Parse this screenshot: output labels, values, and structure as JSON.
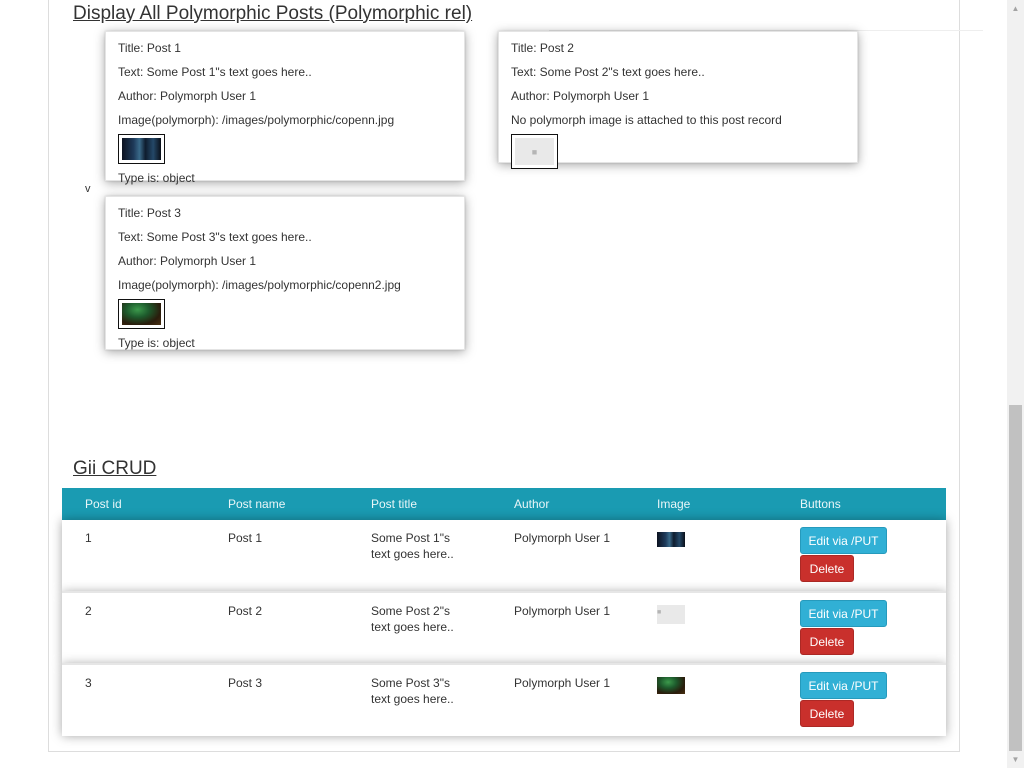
{
  "poly_section": {
    "title": "Display All Polymorphic Posts (Polymorphic rel)",
    "stray_char": "v",
    "posts": [
      {
        "title": "Title: Post 1",
        "text": "Text: Some Post 1\"s text goes here..",
        "author": "Author: Polymorph User 1",
        "image_line": "Image(polymorph): /images/polymorphic/copenn.jpg",
        "type_line": "Type is: object"
      },
      {
        "title": "Title: Post 2",
        "text": "Text: Some Post 2\"s text goes here..",
        "author": "Author: Polymorph User 1",
        "image_line": "No polymorph image is attached to this post record"
      },
      {
        "title": "Title: Post 3",
        "text": "Text: Some Post 3\"s text goes here..",
        "author": "Author: Polymorph User 1",
        "image_line": "Image(polymorph): /images/polymorphic/copenn2.jpg",
        "type_line": "Type is: object"
      }
    ]
  },
  "crud_section": {
    "title": "Gii CRUD",
    "columns": [
      "Post id",
      "Post name",
      "Post title",
      "Author",
      "Image",
      "Buttons"
    ],
    "rows": [
      {
        "id": "1",
        "name": "Post 1",
        "title": "Some Post 1\"s text goes here..",
        "author": "Polymorph User 1",
        "edit_label": "Edit via /PUT",
        "delete_label": "Delete"
      },
      {
        "id": "2",
        "name": "Post 2",
        "title": "Some Post 2\"s text goes here..",
        "author": "Polymorph User 1",
        "edit_label": "Edit via /PUT",
        "delete_label": "Delete"
      },
      {
        "id": "3",
        "name": "Post 3",
        "title": "Some Post 3\"s text goes here..",
        "author": "Polymorph User 1",
        "edit_label": "Edit via /PUT",
        "delete_label": "Delete"
      }
    ]
  },
  "colors": {
    "table_header": "#1a9bb2",
    "edit_button": "#31b0d5",
    "delete_button": "#c9302c"
  }
}
